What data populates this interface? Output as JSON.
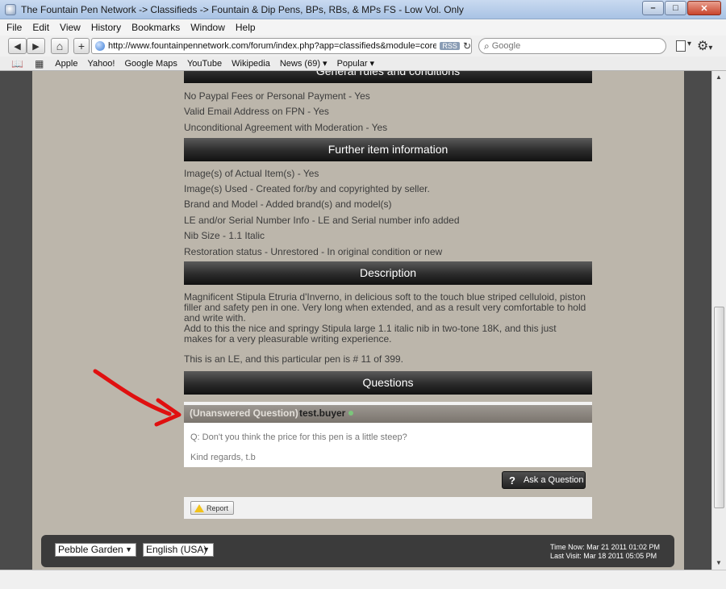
{
  "window": {
    "title": "The Fountain Pen Network -> Classifieds -> Fountain & Dip Pens, BPs, RBs, & MPs FS - Low Vol. Only",
    "buttons": {
      "minimize": "–",
      "maximize": "□",
      "close": "✕"
    }
  },
  "menubar": {
    "items": [
      "File",
      "Edit",
      "View",
      "History",
      "Bookmarks",
      "Window",
      "Help"
    ]
  },
  "toolbar": {
    "back": "◀",
    "forward": "▶",
    "home": "⌂",
    "add": "+",
    "url": "http://www.fountainpennetwork.com/forum/index.php?app=classifieds&module=core&do=vie",
    "rss": "RSS",
    "reload": "↻",
    "search_placeholder": "Google",
    "search_glyph": "⌕",
    "gear": "⚙",
    "gear_caret": "▾"
  },
  "bookmarks": {
    "reader_icon": "📖",
    "grid_icon": "▦",
    "items": [
      "Apple",
      "Yahoo!",
      "Google Maps",
      "YouTube",
      "Wikipedia",
      "News (69) ▾",
      "Popular ▾"
    ]
  },
  "page": {
    "general": {
      "header": "General rules and conditions",
      "lines": [
        "No Paypal Fees or Personal Payment - Yes",
        "Valid Email Address on FPN - Yes",
        "Unconditional Agreement with Moderation - Yes"
      ]
    },
    "further": {
      "header": "Further item information",
      "lines": [
        "Image(s) of Actual Item(s) - Yes",
        "Image(s) Used - Created for/by and copyrighted by seller.",
        "Brand and Model - Added brand(s) and model(s)",
        "LE and/or Serial Number Info - LE and Serial number info added",
        "Nib Size - 1.1 Italic",
        "Restoration status - Unrestored - In original condition or new"
      ]
    },
    "description": {
      "header": "Description",
      "paragraphs": [
        "Magnificent Stipula Etruria d'Inverno, in delicious soft to the touch blue striped celluloid, piston filler and safety pen in one. Very long when extended, and as a result very comfortable to hold and write with.",
        "Add to this the nice and springy Stipula large 1.1 italic nib in two-tone 18K, and this just makes for a very pleasurable writing experience.",
        "This is an LE, and this particular pen is # 11 of 399."
      ]
    },
    "questions": {
      "header": "Questions",
      "tag": "(Unanswered Question)",
      "user": "test.buyer",
      "question": "Q: Don't you think the price for this pen is a little steep?",
      "signoff": "Kind regards, t.b",
      "ask_label": "Ask a Question",
      "ask_glyph": "?"
    },
    "report_label": "Report",
    "footer": {
      "skin": "Pebble Garden",
      "language": "English (USA)",
      "caret": "▼",
      "time_now": "Time Now: Mar 21 2011 01:02 PM",
      "last_visit": "Last Visit: Mar 18 2011 05:05 PM"
    },
    "annotation_color": "#e01010"
  },
  "scroll": {
    "up": "▲",
    "down": "▼"
  }
}
